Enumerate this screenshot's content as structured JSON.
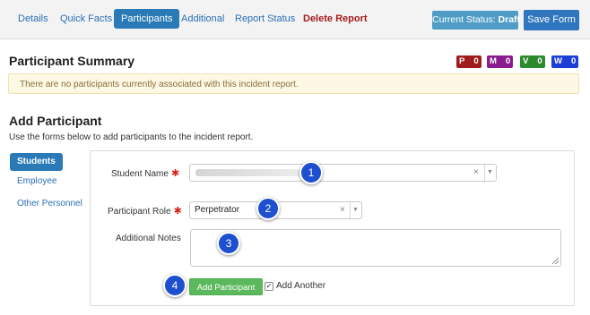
{
  "tabs": [
    {
      "label": "Details",
      "active": false
    },
    {
      "label": "Quick Facts",
      "active": false
    },
    {
      "label": "Participants",
      "active": true
    },
    {
      "label": "Additional",
      "active": false
    },
    {
      "label": "Report Status",
      "active": false
    },
    {
      "label": "Delete Report",
      "active": false
    }
  ],
  "status": {
    "prefix": "Current Status:",
    "value": "Draft",
    "color": "#4f9dc7"
  },
  "save_label": "Save Form",
  "summary": {
    "title": "Participant Summary",
    "badges": [
      {
        "letter": "P",
        "count": "0",
        "color": "#a01b1b"
      },
      {
        "letter": "M",
        "count": "0",
        "color": "#8a1a8f"
      },
      {
        "letter": "V",
        "count": "0",
        "color": "#2c8a2c"
      },
      {
        "letter": "W",
        "count": "0",
        "color": "#1d3fd6"
      }
    ],
    "alert": "There are no participants currently associated with this incident report."
  },
  "add": {
    "title": "Add Participant",
    "intro": "Use the forms below to add participants to the incident report."
  },
  "sidenav": [
    {
      "label": "Students",
      "active": true
    },
    {
      "label": "Employee",
      "active": false
    },
    {
      "label": "Other Personnel",
      "active": false
    }
  ],
  "form": {
    "student_label": "Student Name",
    "student_value": "",
    "role_label": "Participant Role",
    "role_value": "Perpetrator",
    "notes_label": "Additional Notes",
    "notes_value": "",
    "clear_glyph": "×",
    "arrow_glyph": "▼",
    "required_mark": "✱",
    "add_button": "Add Participant",
    "add_another_label": "Add Another",
    "add_another_checked": true,
    "check_glyph": "✓"
  },
  "callouts": [
    "1",
    "2",
    "3",
    "4"
  ],
  "colors": {
    "accent": "#2a7ab8",
    "success": "#5cb85c",
    "warning_bg": "#fcf8e3",
    "callout": "#1d4fcf"
  }
}
